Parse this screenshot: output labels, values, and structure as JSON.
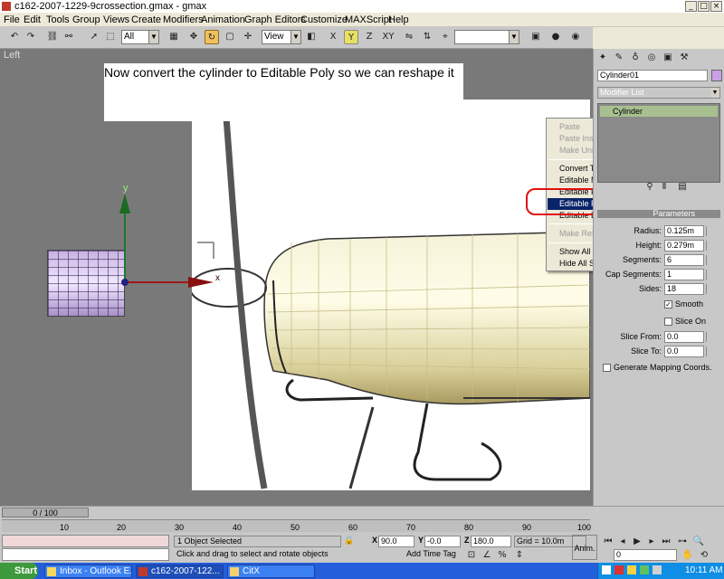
{
  "window": {
    "title": "c162-2007-1229-9crossection.gmax - gmax",
    "minimize": "_",
    "maximize": "□",
    "close": "×"
  },
  "menu": [
    "File",
    "Edit",
    "Tools",
    "Group",
    "Views",
    "Create",
    "Modifiers",
    "Animation",
    "Graph Editors",
    "Customize",
    "MAXScript",
    "Help"
  ],
  "toolbar": {
    "selection_filter": "All",
    "ref_coord": "View"
  },
  "viewport": {
    "label": "Left",
    "axis_y": "y",
    "axis_x": "x"
  },
  "tutorial_text": "Now convert the cylinder to Editable Poly so we can reshape it",
  "context_menu": {
    "items": [
      {
        "label": "Paste",
        "disabled": true
      },
      {
        "label": "Paste Instanced",
        "disabled": true
      },
      {
        "label": "Make Unique",
        "disabled": true
      },
      {
        "label": "Convert To:",
        "disabled": false
      },
      {
        "label": "Editable Mesh",
        "disabled": false
      },
      {
        "label": "Editable Patch",
        "disabled": false
      },
      {
        "label": "Editable Poly",
        "disabled": false,
        "highlighted": true
      },
      {
        "label": "Editable Brush",
        "disabled": false
      },
      {
        "label": "Make Reference",
        "disabled": true
      },
      {
        "label": "Show All Subtrees",
        "disabled": false
      },
      {
        "label": "Hide All Subtrees",
        "disabled": false
      }
    ]
  },
  "command_panel": {
    "object_name": "Cylinder01",
    "modifier_list": "Modifier List",
    "stack_item": "Cylinder",
    "params_title": "Parameters",
    "radius_label": "Radius:",
    "radius": "0.125m",
    "height_label": "Height:",
    "height": "0.279m",
    "hsegs_label": "Segments:",
    "hsegs": "6",
    "capsegs_label": "Cap Segments:",
    "capsegs": "1",
    "sides_label": "Sides:",
    "sides": "18",
    "smooth": "Smooth",
    "slice_on": "Slice On",
    "slice_from_label": "Slice From:",
    "slice_from": "0.0",
    "slice_to_label": "Slice To:",
    "slice_to": "0.0",
    "gen_mapping": "Generate Mapping Coords."
  },
  "timeline": {
    "frame": "0 / 100",
    "ticks": [
      "10",
      "20",
      "30",
      "40",
      "50",
      "60",
      "70",
      "80",
      "90",
      "100"
    ]
  },
  "status": {
    "selected": "1 Object Selected",
    "prompt": "Click and drag to select and rotate objects",
    "x_label": "X",
    "x": "90.0",
    "y_label": "Y",
    "y": "-0.0",
    "z_label": "Z",
    "z": "180.0",
    "grid": "Grid = 10.0m",
    "add_time_tag": "Add Time Tag",
    "anim": "Anim.",
    "frame_field": "0"
  },
  "taskbar": {
    "start": "Start",
    "tasks": [
      "Inbox - Outlook E...",
      "c162-2007-122...",
      "CitX"
    ],
    "clock": "10:11 AM"
  }
}
